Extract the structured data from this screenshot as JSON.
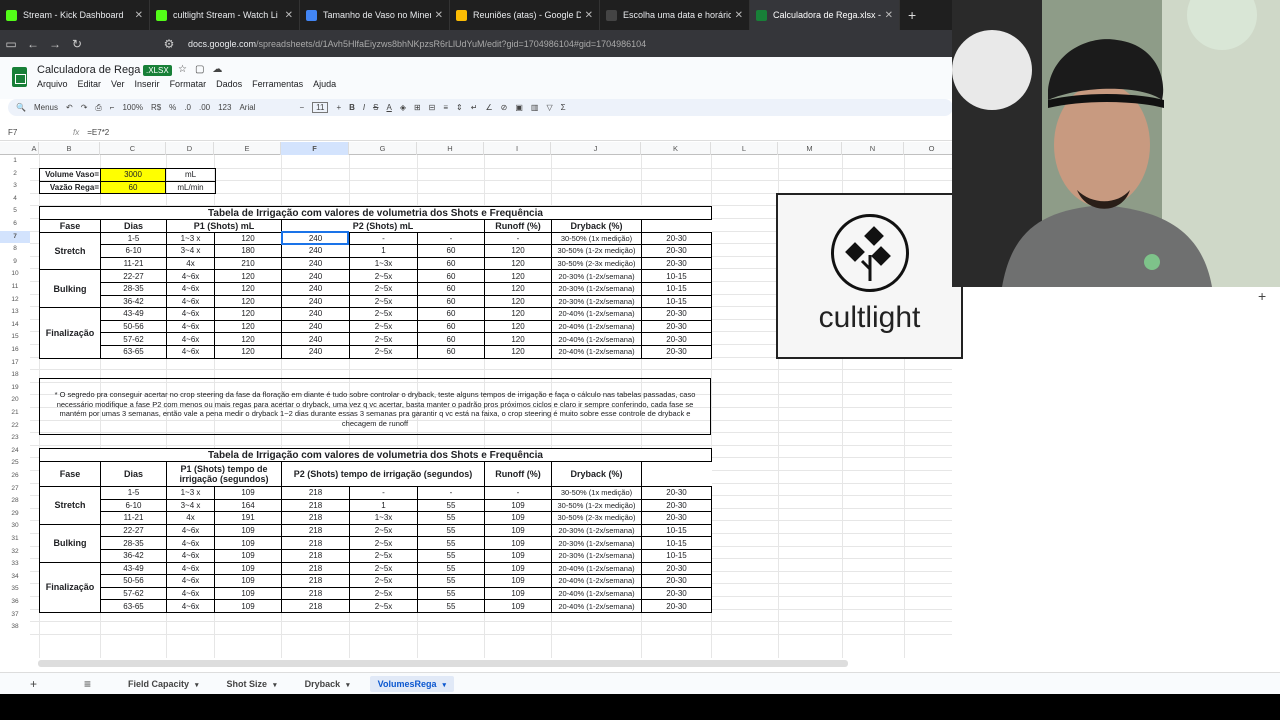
{
  "browser": {
    "tabs": [
      {
        "label": "Stream - Kick Dashboard",
        "color": "#53fc18",
        "active": false
      },
      {
        "label": "cultlight Stream - Watch Li",
        "color": "#53fc18",
        "active": false
      },
      {
        "label": "Tamanho de Vaso no Mineral - ",
        "color": "#4285f4",
        "active": false
      },
      {
        "label": "Reuniões (atas) - Google Drive",
        "color": "#fbbc04",
        "active": false
      },
      {
        "label": "Escolha uma data e horário - C",
        "color": "#444444",
        "active": false
      },
      {
        "label": "Calculadora de Rega.xlsx - Goo",
        "color": "#188038",
        "active": true
      }
    ],
    "new_tab": "+",
    "url_host": "docs.google.com",
    "url_path": "/spreadsheets/d/1Avh5HlfaEiyzws8bhNKpzsR6rLlUdYuM/edit?gid=1704986104#gid=1704986104"
  },
  "doc": {
    "title": "Calculadora de Rega",
    "badge": ".XLSX",
    "menus": [
      "Arquivo",
      "Editar",
      "Ver",
      "Inserir",
      "Formatar",
      "Dados",
      "Ferramentas",
      "Ajuda"
    ]
  },
  "toolbar": {
    "menus": "Menus",
    "zoom": "100%",
    "currency": "R$",
    "percent": "%",
    "dec_less": ".0",
    "dec_more": ".00",
    "format_123": "123",
    "font": "Arial",
    "font_size": "11",
    "minus": "−",
    "plus": "+",
    "bold": "B",
    "italic": "I",
    "strike": "S",
    "underline": "A",
    "sigma": "Σ"
  },
  "formula": {
    "cell_ref": "F7",
    "fx": "fx",
    "value": "=E7*2"
  },
  "columns": [
    "A",
    "B",
    "C",
    "D",
    "E",
    "F",
    "G",
    "H",
    "I",
    "J",
    "K",
    "L",
    "M",
    "N",
    "O"
  ],
  "rows": [
    "1",
    "2",
    "3",
    "4",
    "5",
    "6",
    "7",
    "8",
    "9",
    "10",
    "11",
    "12",
    "13",
    "14",
    "15",
    "16",
    "17",
    "18",
    "19",
    "20",
    "21",
    "22",
    "23",
    "24",
    "25",
    "26",
    "27",
    "28",
    "29",
    "30",
    "31",
    "32",
    "33",
    "34",
    "35",
    "36",
    "37",
    "38"
  ],
  "settings": {
    "volume_label": "Volume Vaso=",
    "volume_value": "3000",
    "volume_unit": "mL",
    "flow_label": "Vazão Rega=",
    "flow_value": "60",
    "flow_unit": "mL/min"
  },
  "table1": {
    "title": "Tabela de Irrigação com valores de volumetria dos Shots e Frequência",
    "headers": [
      "Fase",
      "Dias",
      "P1 (Shots) mL",
      "P2 (Shots) mL",
      "Runoff (%)",
      "Dryback (%)"
    ],
    "phases": [
      "Stretch",
      "Bulking",
      "Finalização"
    ],
    "rows": [
      [
        "1-5",
        "1~3 x",
        "120",
        "240",
        "-",
        "-",
        "-",
        "30-50% (1x medição)",
        "20-30"
      ],
      [
        "6-10",
        "3~4 x",
        "180",
        "240",
        "1",
        "60",
        "120",
        "30-50% (1-2x medição)",
        "20-30"
      ],
      [
        "11-21",
        "4x",
        "210",
        "240",
        "1~3x",
        "60",
        "120",
        "30-50% (2-3x medição)",
        "20-30"
      ],
      [
        "22-27",
        "4~6x",
        "120",
        "240",
        "2~5x",
        "60",
        "120",
        "20-30% (1-2x/semana)",
        "10-15"
      ],
      [
        "28-35",
        "4~6x",
        "120",
        "240",
        "2~5x",
        "60",
        "120",
        "20-30% (1-2x/semana)",
        "10-15"
      ],
      [
        "36-42",
        "4~6x",
        "120",
        "240",
        "2~5x",
        "60",
        "120",
        "20-30% (1-2x/semana)",
        "10-15"
      ],
      [
        "43-49",
        "4~6x",
        "120",
        "240",
        "2~5x",
        "60",
        "120",
        "20-40% (1-2x/semana)",
        "20-30"
      ],
      [
        "50-56",
        "4~6x",
        "120",
        "240",
        "2~5x",
        "60",
        "120",
        "20-40% (1-2x/semana)",
        "20-30"
      ],
      [
        "57-62",
        "4~6x",
        "120",
        "240",
        "2~5x",
        "60",
        "120",
        "20-40% (1-2x/semana)",
        "20-30"
      ],
      [
        "63-65",
        "4~6x",
        "120",
        "240",
        "2~5x",
        "60",
        "120",
        "20-40% (1-2x/semana)",
        "20-30"
      ]
    ]
  },
  "note": "* O segredo pra conseguir acertar no crop steering da fase da floração em diante é tudo sobre controlar o dryback, teste alguns tempos de irrigação e faça o cálculo nas tabelas passadas, caso necessário modifique a fase P2 com menos ou mais regas para acertar o dryback, uma vez q vc acertar, basta manter o padrão pros próximos ciclos e claro ir sempre conferindo, cada fase se mantém por umas 3 semanas, então vale a pena medir o dryback 1~2 dias durante essas 3 semanas pra garantir q vc está na faixa, o crop steering é muito sobre esse controle de dryback e checagem de runoff",
  "table2": {
    "title": "Tabela de Irrigação com valores de volumetria dos Shots e Frequência",
    "headers": [
      "Fase",
      "Dias",
      "P1 (Shots) tempo de irrigação (segundos)",
      "P2 (Shots) tempo de irrigação (segundos)",
      "Runoff (%)",
      "Dryback (%)"
    ],
    "phases": [
      "Stretch",
      "Bulking",
      "Finalização"
    ],
    "rows": [
      [
        "1-5",
        "1~3 x",
        "109",
        "218",
        "-",
        "-",
        "-",
        "30-50% (1x medição)",
        "20-30"
      ],
      [
        "6-10",
        "3~4 x",
        "164",
        "218",
        "1",
        "55",
        "109",
        "30-50% (1-2x medição)",
        "20-30"
      ],
      [
        "11-21",
        "4x",
        "191",
        "218",
        "1~3x",
        "55",
        "109",
        "30-50% (2-3x medição)",
        "20-30"
      ],
      [
        "22-27",
        "4~6x",
        "109",
        "218",
        "2~5x",
        "55",
        "109",
        "20-30% (1-2x/semana)",
        "10-15"
      ],
      [
        "28-35",
        "4~6x",
        "109",
        "218",
        "2~5x",
        "55",
        "109",
        "20-30% (1-2x/semana)",
        "10-15"
      ],
      [
        "36-42",
        "4~6x",
        "109",
        "218",
        "2~5x",
        "55",
        "109",
        "20-30% (1-2x/semana)",
        "10-15"
      ],
      [
        "43-49",
        "4~6x",
        "109",
        "218",
        "2~5x",
        "55",
        "109",
        "20-40% (1-2x/semana)",
        "20-30"
      ],
      [
        "50-56",
        "4~6x",
        "109",
        "218",
        "2~5x",
        "55",
        "109",
        "20-40% (1-2x/semana)",
        "20-30"
      ],
      [
        "57-62",
        "4~6x",
        "109",
        "218",
        "2~5x",
        "55",
        "109",
        "20-40% (1-2x/semana)",
        "20-30"
      ],
      [
        "63-65",
        "4~6x",
        "109",
        "218",
        "2~5x",
        "55",
        "109",
        "20-40% (1-2x/semana)",
        "20-30"
      ]
    ]
  },
  "overlay": {
    "logo_text": "cultlight"
  },
  "sheets": {
    "add": "+",
    "list_icon": "≡",
    "tabs": [
      "Field Capacity",
      "Shot Size",
      "Dryback",
      "VolumesRega"
    ],
    "active": "VolumesRega",
    "caret": "▾"
  }
}
